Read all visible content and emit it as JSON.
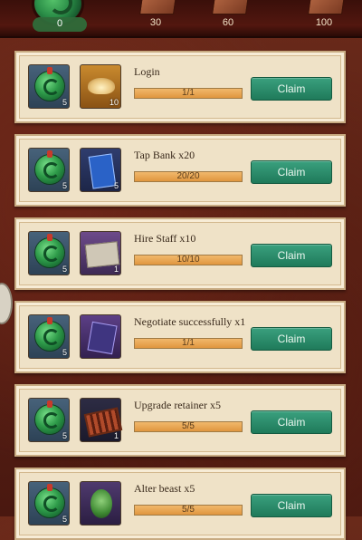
{
  "top": {
    "score": "0",
    "milestones": [
      "30",
      "60",
      "100"
    ]
  },
  "tasks": [
    {
      "title": "Login",
      "progress": "1/1",
      "progress_fraction": 1,
      "jade_count": "5",
      "reward_icon": "gold-ingot-icon",
      "reward_count": "10",
      "claim": "Claim"
    },
    {
      "title": "Tap Bank x20",
      "progress": "20/20",
      "progress_fraction": 1,
      "jade_count": "5",
      "reward_icon": "bank-card-icon",
      "reward_count": "5",
      "claim": "Claim"
    },
    {
      "title": "Hire Staff x10",
      "progress": "10/10",
      "progress_fraction": 1,
      "jade_count": "5",
      "reward_icon": "scroll-icon",
      "reward_count": "1",
      "claim": "Claim"
    },
    {
      "title": "Negotiate successfully x1",
      "progress": "1/1",
      "progress_fraction": 1,
      "jade_count": "5",
      "reward_icon": "ticket-icon",
      "reward_count": "",
      "claim": "Claim"
    },
    {
      "title": "Upgrade retainer x5",
      "progress": "5/5",
      "progress_fraction": 1,
      "jade_count": "5",
      "reward_icon": "abacus-icon",
      "reward_count": "1",
      "claim": "Claim"
    },
    {
      "title": "Alter beast x5",
      "progress": "5/5",
      "progress_fraction": 1,
      "jade_count": "5",
      "reward_icon": "beetle-icon",
      "reward_count": "",
      "claim": "Claim"
    }
  ]
}
